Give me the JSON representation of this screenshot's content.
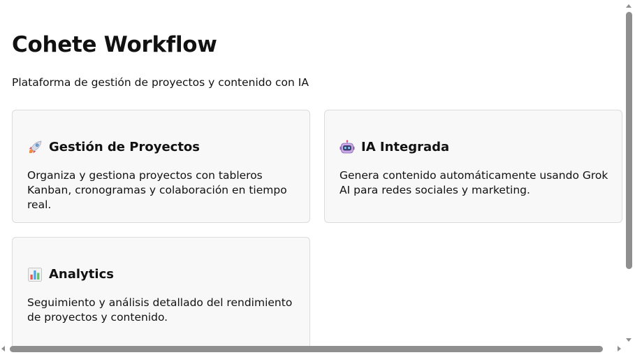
{
  "header": {
    "title": "Cohete Workflow",
    "subtitle": "Plataforma de gestión de proyectos y contenido con IA"
  },
  "features": [
    {
      "icon": "rocket-icon",
      "title": "Gestión de Proyectos",
      "description": "Organiza y gestiona proyectos con tableros Kanban, cronogramas y colaboración en tiempo real."
    },
    {
      "icon": "robot-icon",
      "title": "IA Integrada",
      "description": "Genera contenido automáticamente usando Grok AI para redes sociales y marketing."
    },
    {
      "icon": "bar-chart-icon",
      "title": "Analytics",
      "description": "Seguimiento y análisis detallado del rendimiento de proyectos y contenido."
    }
  ],
  "colors": {
    "card_background": "#f8f8f8",
    "card_border": "#dcdcdc",
    "scrollbar_thumb": "#8f8f8f"
  }
}
